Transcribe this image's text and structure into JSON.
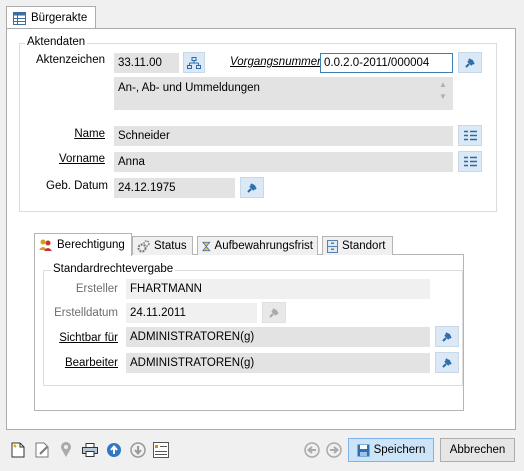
{
  "window_tab": {
    "label": "Bürgerakte",
    "icon": "table-icon"
  },
  "aktendaten": {
    "legend": "Aktendaten",
    "aktenzeichen_label": "Aktenzeichen",
    "aktenzeichen_value": "33.11.00",
    "vorgangsnummer_label": "Vorgangsnummer",
    "vorgangsnummer_value": "0.0.2.0-2011/000004",
    "description": "An-, Ab- und Ummeldungen",
    "name_label": "Name",
    "name_value": "Schneider",
    "vorname_label": "Vorname",
    "vorname_value": "Anna",
    "geb_datum_label": "Geb. Datum",
    "geb_datum_value": "24.12.1975"
  },
  "tabs": [
    {
      "label": "Berechtigung",
      "icon": "users-icon",
      "active": true
    },
    {
      "label": "Status",
      "icon": "gears-icon",
      "active": false
    },
    {
      "label": "Aufbewahrungsfrist",
      "icon": "hourglass-icon",
      "active": false
    },
    {
      "label": "Standort",
      "icon": "cabinet-icon",
      "active": false
    }
  ],
  "standardrechtevergabe": {
    "legend": "Standardrechtevergabe",
    "ersteller_label": "Ersteller",
    "ersteller_value": "FHARTMANN",
    "erstelldatum_label": "Erstelldatum",
    "erstelldatum_value": "24.11.2011",
    "sichtbar_label": "Sichtbar für",
    "sichtbar_value": "ADMINISTRATOREN(g)",
    "bearbeiter_label": "Bearbeiter",
    "bearbeiter_value": "ADMINISTRATOREN(g)"
  },
  "buttons": {
    "save": "Speichern",
    "cancel": "Abbrechen"
  },
  "colors": {
    "accent_button": "#cce4f7",
    "field_bg": "#e3e3e3",
    "pin_icon": "#2a6aa8"
  }
}
